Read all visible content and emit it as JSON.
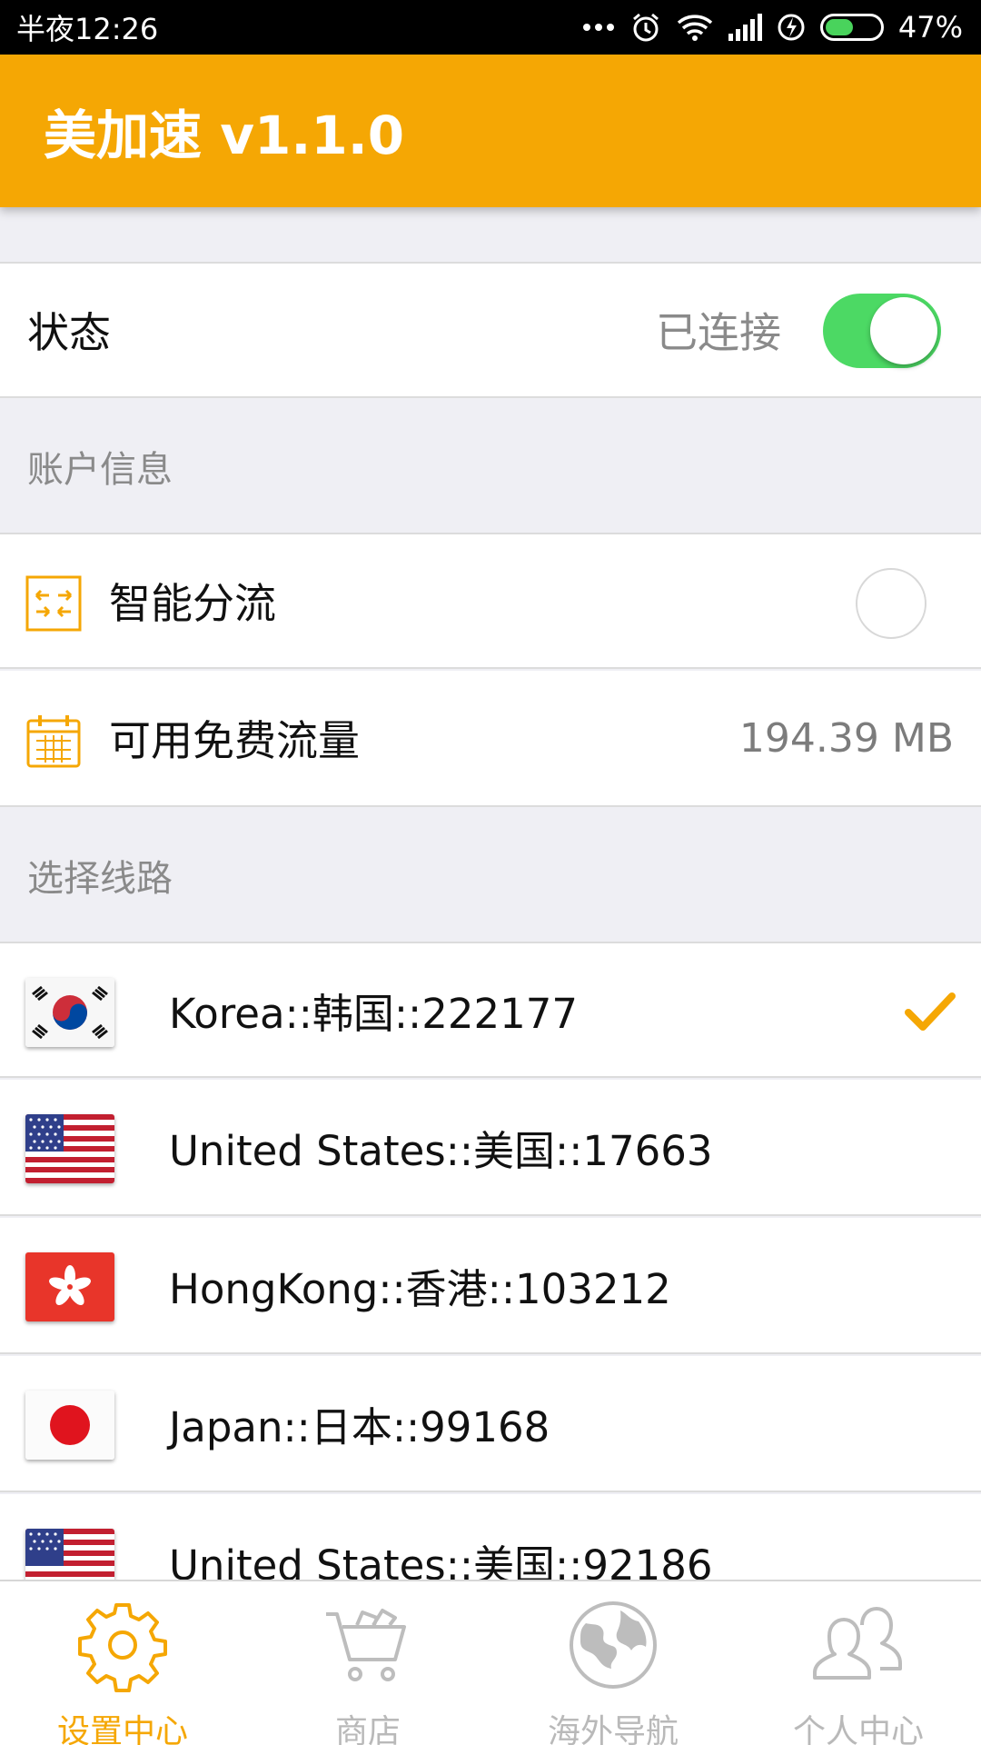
{
  "status_bar": {
    "time": "半夜12:26",
    "battery": "47%",
    "battery_level": 0.47
  },
  "app_bar": {
    "title": "美加速 v1.1.0"
  },
  "status_row": {
    "label": "状态",
    "value": "已连接",
    "toggle_on": true
  },
  "account_section": {
    "header": "账户信息",
    "smart_routing": {
      "label": "智能分流",
      "checked": false
    },
    "free_traffic": {
      "label": "可用免费流量",
      "value": "194.39 MB"
    }
  },
  "route_section": {
    "header": "选择线路",
    "servers": [
      {
        "name": "Korea::韩国::222177",
        "flag": "korea-flag-icon",
        "selected": true
      },
      {
        "name": "United States::美国::17663",
        "flag": "us-flag-icon",
        "selected": false
      },
      {
        "name": "HongKong::香港::103212",
        "flag": "hongkong-flag-icon",
        "selected": false
      },
      {
        "name": "Japan::日本::99168",
        "flag": "japan-flag-icon",
        "selected": false
      },
      {
        "name": "United States::美国::92186",
        "flag": "us-flag-icon",
        "selected": false
      }
    ]
  },
  "bottom_nav": {
    "items": [
      {
        "label": "设置中心",
        "icon": "gear-icon",
        "active": true
      },
      {
        "label": "商店",
        "icon": "shopping-cart-icon",
        "active": false
      },
      {
        "label": "海外导航",
        "icon": "globe-icon",
        "active": false
      },
      {
        "label": "个人中心",
        "icon": "users-icon",
        "active": false
      }
    ]
  },
  "colors": {
    "accent": "#f5a704",
    "toggle_on": "#4cd964",
    "background": "#efeff4"
  }
}
